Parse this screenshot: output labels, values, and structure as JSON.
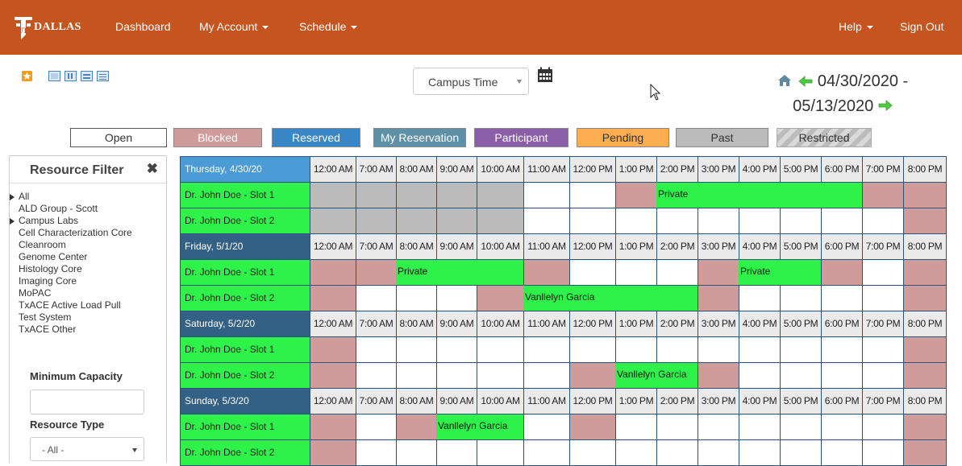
{
  "nav": {
    "brand": "DALLAS",
    "items": [
      {
        "label": "Dashboard",
        "caret": false
      },
      {
        "label": "My Account",
        "caret": true
      },
      {
        "label": "Schedule",
        "caret": true
      },
      {
        "label": "Help",
        "caret": true
      },
      {
        "label": "Sign Out",
        "caret": false
      }
    ]
  },
  "toolbar": {
    "timezone": "Campus Time",
    "date_start": "04/30/2020 -",
    "date_end": "05/13/2020"
  },
  "legend": [
    {
      "label": "Open",
      "bg": "#ffffff",
      "color": "#333333"
    },
    {
      "label": "Blocked",
      "bg": "#cf9b9b",
      "color": "#ffffff"
    },
    {
      "label": "Reserved",
      "bg": "#3a87c8",
      "color": "#ffffff"
    },
    {
      "label": "My Reservation",
      "bg": "#5e90a8",
      "color": "#ffffff"
    },
    {
      "label": "Participant",
      "bg": "#8a5fa8",
      "color": "#ffffff"
    },
    {
      "label": "Pending",
      "bg": "#fbad4f",
      "color": "#333333"
    },
    {
      "label": "Past",
      "bg": "#bbbbbb",
      "color": "#333333"
    },
    {
      "label": "Restricted",
      "bg": "#cccccc",
      "color": "#333333"
    }
  ],
  "filter": {
    "title": "Resource Filter",
    "resources": [
      {
        "label": "All",
        "expand": true
      },
      {
        "label": "ALD Group - Scott",
        "expand": false
      },
      {
        "label": "Campus Labs",
        "expand": true
      },
      {
        "label": "Cell Characterization Core",
        "expand": false
      },
      {
        "label": "Cleanroom",
        "expand": false
      },
      {
        "label": "Genome Center",
        "expand": false
      },
      {
        "label": "Histology Core",
        "expand": false
      },
      {
        "label": "Imaging Core",
        "expand": false
      },
      {
        "label": "MoPAC",
        "expand": false
      },
      {
        "label": "TxACE Active Load Pull",
        "expand": false
      },
      {
        "label": "Test System",
        "expand": false
      },
      {
        "label": "TxACE Other",
        "expand": false
      }
    ],
    "min_capacity_label": "Minimum Capacity",
    "min_capacity_value": "",
    "resource_type_label": "Resource Type",
    "resource_type_value": "- All -"
  },
  "schedule": {
    "hours": [
      "12:00 AM",
      "7:00 AM",
      "8:00 AM",
      "9:00 AM",
      "10:00 AM",
      "11:00 AM",
      "12:00 PM",
      "1:00 PM",
      "2:00 PM",
      "3:00 PM",
      "4:00 PM",
      "5:00 PM",
      "6:00 PM",
      "7:00 PM",
      "8:00 PM"
    ],
    "colors": {
      "open": "#ffffff",
      "blocked": "#cf9b9b",
      "past": "#bbbbbb",
      "reserved": "#2ef24a",
      "hdr_today": "#4a9bd6",
      "hdr_day": "#336185",
      "hour_bg": "#eaeaea"
    },
    "days": [
      {
        "label": "Thursday, 4/30/20",
        "today": true,
        "rows": [
          {
            "resource": "Dr. John Doe - Slot 1",
            "cells": [
              "P",
              "P",
              "P",
              "P",
              "P",
              "O",
              "O",
              "B",
              "R",
              "R",
              "R",
              "R",
              "R",
              "B",
              "B"
            ],
            "labels": [
              {
                "col": 8,
                "text": "Private"
              }
            ]
          },
          {
            "resource": "Dr. John Doe - Slot 2",
            "cells": [
              "P",
              "P",
              "P",
              "P",
              "P",
              "O",
              "O",
              "O",
              "O",
              "O",
              "O",
              "O",
              "O",
              "O",
              "B"
            ],
            "labels": []
          }
        ]
      },
      {
        "label": "Friday, 5/1/20",
        "today": false,
        "rows": [
          {
            "resource": "Dr. John Doe - Slot 1",
            "cells": [
              "B",
              "B",
              "R",
              "R",
              "R",
              "B",
              "O",
              "O",
              "O",
              "B",
              "R",
              "R",
              "B",
              "O",
              "B"
            ],
            "labels": [
              {
                "col": 2,
                "text": "Private"
              },
              {
                "col": 10,
                "text": "Private"
              }
            ]
          },
          {
            "resource": "Dr. John Doe - Slot 2",
            "cells": [
              "B",
              "O",
              "O",
              "O",
              "B",
              "R",
              "R",
              "R",
              "R",
              "B",
              "O",
              "O",
              "O",
              "O",
              "B"
            ],
            "labels": [
              {
                "col": 5,
                "text": "Vanllelyn Garcia"
              }
            ]
          }
        ]
      },
      {
        "label": "Saturday, 5/2/20",
        "today": false,
        "rows": [
          {
            "resource": "Dr. John Doe - Slot 1",
            "cells": [
              "B",
              "O",
              "O",
              "O",
              "O",
              "O",
              "O",
              "O",
              "O",
              "O",
              "O",
              "O",
              "O",
              "O",
              "B"
            ],
            "labels": []
          },
          {
            "resource": "Dr. John Doe - Slot 2",
            "cells": [
              "B",
              "O",
              "O",
              "O",
              "O",
              "O",
              "B",
              "R",
              "R",
              "B",
              "O",
              "O",
              "O",
              "O",
              "B"
            ],
            "labels": [
              {
                "col": 7,
                "text": "Vanllelyn Garcia"
              }
            ]
          }
        ]
      },
      {
        "label": "Sunday, 5/3/20",
        "today": false,
        "rows": [
          {
            "resource": "Dr. John Doe - Slot 1",
            "cells": [
              "B",
              "O",
              "B",
              "R",
              "R",
              "O",
              "B",
              "O",
              "O",
              "O",
              "O",
              "O",
              "O",
              "O",
              "B"
            ],
            "labels": [
              {
                "col": 3,
                "text": "Vanllelyn Garcia"
              }
            ]
          },
          {
            "resource": "Dr. John Doe - Slot 2",
            "cells": [
              "B",
              "O",
              "O",
              "O",
              "O",
              "O",
              "O",
              "O",
              "O",
              "O",
              "O",
              "O",
              "O",
              "O",
              "B"
            ],
            "labels": []
          }
        ]
      }
    ]
  }
}
